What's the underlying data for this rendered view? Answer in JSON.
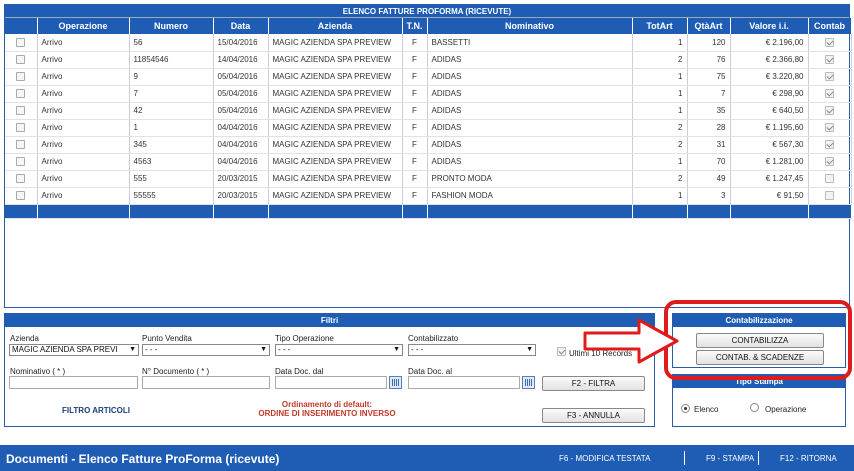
{
  "list": {
    "title": "ELENCO FATTURE PROFORMA (RICEVUTE)",
    "columns": [
      "",
      "Operazione",
      "Numero",
      "Data",
      "Azienda",
      "T.N.",
      "Nominativo",
      "TotArt",
      "QtàArt",
      "Valore i.i.",
      "Contab"
    ],
    "rows": [
      {
        "operazione": "Arrivo",
        "numero": "56",
        "data": "15/04/2016",
        "azienda": "MAGIC AZIENDA SPA PREVIEW",
        "tn": "F",
        "nominativo": "BASSETTI",
        "totart": "1",
        "qtaart": "120",
        "valore": "€ 2.196,00",
        "contab": true
      },
      {
        "operazione": "Arrivo",
        "numero": "11854546",
        "data": "14/04/2016",
        "azienda": "MAGIC AZIENDA SPA PREVIEW",
        "tn": "F",
        "nominativo": "ADIDAS",
        "totart": "2",
        "qtaart": "76",
        "valore": "€ 2.366,80",
        "contab": true
      },
      {
        "operazione": "Arrivo",
        "numero": "9",
        "data": "05/04/2016",
        "azienda": "MAGIC AZIENDA SPA PREVIEW",
        "tn": "F",
        "nominativo": "ADIDAS",
        "totart": "1",
        "qtaart": "75",
        "valore": "€ 3.220,80",
        "contab": true
      },
      {
        "operazione": "Arrivo",
        "numero": "7",
        "data": "05/04/2016",
        "azienda": "MAGIC AZIENDA SPA PREVIEW",
        "tn": "F",
        "nominativo": "ADIDAS",
        "totart": "1",
        "qtaart": "7",
        "valore": "€ 298,90",
        "contab": true
      },
      {
        "operazione": "Arrivo",
        "numero": "42",
        "data": "05/04/2016",
        "azienda": "MAGIC AZIENDA SPA PREVIEW",
        "tn": "F",
        "nominativo": "ADIDAS",
        "totart": "1",
        "qtaart": "35",
        "valore": "€ 640,50",
        "contab": true
      },
      {
        "operazione": "Arrivo",
        "numero": "1",
        "data": "04/04/2016",
        "azienda": "MAGIC AZIENDA SPA PREVIEW",
        "tn": "F",
        "nominativo": "ADIDAS",
        "totart": "2",
        "qtaart": "28",
        "valore": "€ 1.195,60",
        "contab": true
      },
      {
        "operazione": "Arrivo",
        "numero": "345",
        "data": "04/04/2016",
        "azienda": "MAGIC AZIENDA SPA PREVIEW",
        "tn": "F",
        "nominativo": "ADIDAS",
        "totart": "2",
        "qtaart": "31",
        "valore": "€ 567,30",
        "contab": true
      },
      {
        "operazione": "Arrivo",
        "numero": "4563",
        "data": "04/04/2016",
        "azienda": "MAGIC AZIENDA SPA PREVIEW",
        "tn": "F",
        "nominativo": "ADIDAS",
        "totart": "1",
        "qtaart": "70",
        "valore": "€ 1.281,00",
        "contab": true
      },
      {
        "operazione": "Arrivo",
        "numero": "555",
        "data": "20/03/2015",
        "azienda": "MAGIC AZIENDA SPA PREVIEW",
        "tn": "F",
        "nominativo": "PRONTO MODA",
        "totart": "2",
        "qtaart": "49",
        "valore": "€ 1.247,45",
        "contab": false
      },
      {
        "operazione": "Arrivo",
        "numero": "55555",
        "data": "20/03/2015",
        "azienda": "MAGIC AZIENDA SPA PREVIEW",
        "tn": "F",
        "nominativo": "FASHION MODA",
        "totart": "1",
        "qtaart": "3",
        "valore": "€ 91,50",
        "contab": false
      }
    ]
  },
  "filters": {
    "title": "Filtri",
    "azienda_label": "Azienda",
    "azienda_value": "MAGIC AZIENDA SPA PREVI",
    "punto_vendita_label": "Punto Vendita",
    "punto_vendita_value": "- - -",
    "tipo_operazione_label": "Tipo Operazione",
    "tipo_operazione_value": "- - -",
    "contabilizzato_label": "Contabilizzato",
    "contabilizzato_value": "- - -",
    "ultimi_label": "Ultimi 10 Records",
    "nominativo_label": "Nominativo ( * )",
    "ndocumento_label": "N° Documento ( * )",
    "data_dal_label": "Data Doc. dal",
    "data_al_label": "Data Doc. al",
    "filtra_button": "F2 - FILTRA",
    "annulla_button": "F3 - ANNULLA",
    "filtro_articoli": "FILTRO ARTICOLI",
    "ordinamento_line1": "Ordinamento di default:",
    "ordinamento_line2": "ORDINE DI INSERIMENTO INVERSO"
  },
  "contabilizzazione": {
    "title": "Contabilizzazione",
    "contabilizza_button": "CONTABILIZZA",
    "contab_scadenze_button": "CONTAB. & SCADENZE"
  },
  "tipo_stampa": {
    "title": "Tipo Stampa",
    "options": [
      "Elenco",
      "Operazione"
    ],
    "selected": "Elenco"
  },
  "bottombar": {
    "title": "Documenti - Elenco Fatture ProForma (ricevute)",
    "f6": "F6 - MODIFICA TESTATA",
    "f9": "F9 - STAMPA",
    "f12": "F12 - RITORNA"
  },
  "colors": {
    "header_blue": "#1f5db5",
    "highlight_red": "#e01b1b",
    "ordinamento_red": "#c0392b"
  }
}
